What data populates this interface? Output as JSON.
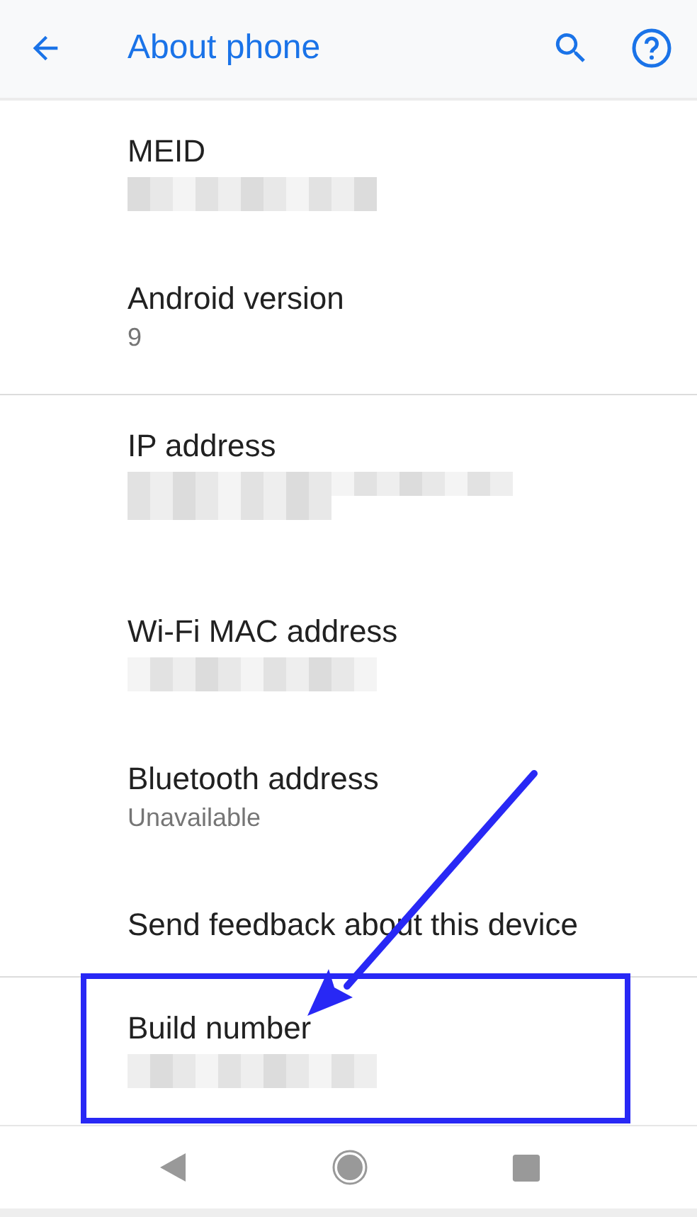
{
  "app_bar": {
    "title": "About phone"
  },
  "items": [
    {
      "title": "MEID",
      "kind": "blurred",
      "divider_after": false,
      "highlighted": false
    },
    {
      "title": "Android version",
      "kind": "summary",
      "summary": "9",
      "divider_after": true,
      "highlighted": false
    },
    {
      "title": "IP address",
      "kind": "blurred-wide",
      "divider_after": false,
      "highlighted": false
    },
    {
      "title": "Wi-Fi MAC address",
      "kind": "blurred",
      "divider_after": false,
      "highlighted": false
    },
    {
      "title": "Bluetooth address",
      "kind": "summary",
      "summary": "Unavailable",
      "divider_after": false,
      "highlighted": false
    },
    {
      "title": "Send feedback about this device",
      "kind": "plain",
      "divider_after": true,
      "highlighted": false
    },
    {
      "title": "Build number",
      "kind": "blurred",
      "divider_after": false,
      "highlighted": true
    }
  ]
}
